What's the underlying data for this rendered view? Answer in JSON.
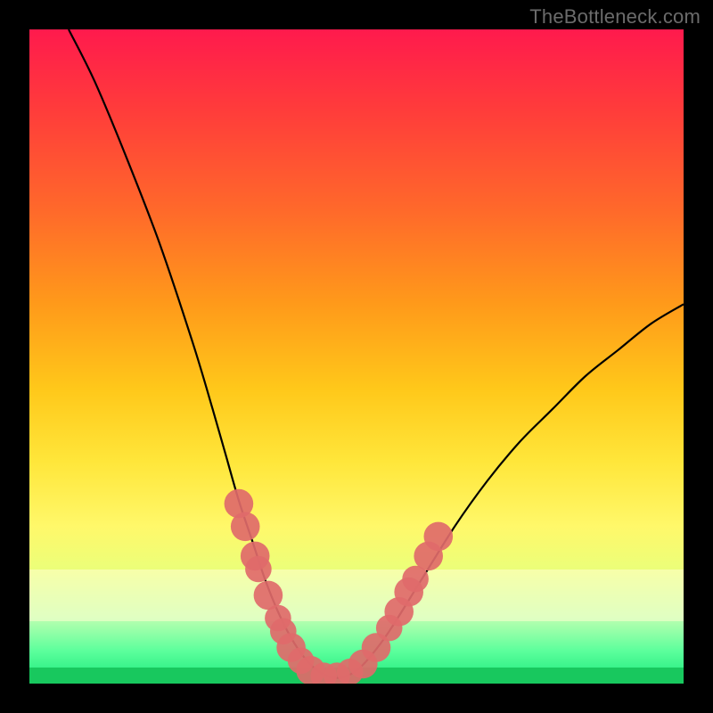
{
  "attribution": "TheBottleneck.com",
  "colors": {
    "frame": "#000000",
    "curve": "#000000",
    "bead": "#e06a6a",
    "green": "#18c85e"
  },
  "chart_data": {
    "type": "line",
    "title": "",
    "xlabel": "",
    "ylabel": "",
    "xlim": [
      0,
      100
    ],
    "ylim": [
      0,
      100
    ],
    "series": [
      {
        "name": "bottleneck-curve",
        "x": [
          6,
          10,
          15,
          20,
          25,
          28,
          30,
          32,
          34,
          36,
          38,
          40,
          42,
          44,
          46,
          48,
          50,
          52,
          55,
          60,
          65,
          70,
          75,
          80,
          85,
          90,
          95,
          100
        ],
        "y": [
          100,
          92,
          80,
          67,
          52,
          42,
          35,
          28,
          22,
          16,
          11,
          7,
          4,
          2,
          1,
          1,
          2,
          4,
          8,
          16,
          24,
          31,
          37,
          42,
          47,
          51,
          55,
          58
        ]
      }
    ],
    "markers": {
      "name": "highlight-beads",
      "points": [
        {
          "x": 32.0,
          "y": 27.5,
          "r": 1.4
        },
        {
          "x": 33.0,
          "y": 24.0,
          "r": 1.4
        },
        {
          "x": 34.5,
          "y": 19.5,
          "r": 1.4
        },
        {
          "x": 35.0,
          "y": 17.5,
          "r": 1.2
        },
        {
          "x": 36.5,
          "y": 13.5,
          "r": 1.4
        },
        {
          "x": 38.0,
          "y": 10.0,
          "r": 1.2
        },
        {
          "x": 38.8,
          "y": 8.0,
          "r": 1.2
        },
        {
          "x": 40.0,
          "y": 5.5,
          "r": 1.4
        },
        {
          "x": 41.5,
          "y": 3.5,
          "r": 1.2
        },
        {
          "x": 43.0,
          "y": 2.0,
          "r": 1.4
        },
        {
          "x": 45.0,
          "y": 1.2,
          "r": 1.2
        },
        {
          "x": 47.0,
          "y": 1.2,
          "r": 1.2
        },
        {
          "x": 49.0,
          "y": 1.8,
          "r": 1.2
        },
        {
          "x": 51.0,
          "y": 3.0,
          "r": 1.4
        },
        {
          "x": 53.0,
          "y": 5.5,
          "r": 1.4
        },
        {
          "x": 55.0,
          "y": 8.5,
          "r": 1.2
        },
        {
          "x": 56.5,
          "y": 11.0,
          "r": 1.4
        },
        {
          "x": 58.0,
          "y": 14.0,
          "r": 1.4
        },
        {
          "x": 59.0,
          "y": 16.0,
          "r": 1.2
        },
        {
          "x": 61.0,
          "y": 19.5,
          "r": 1.4
        },
        {
          "x": 62.5,
          "y": 22.5,
          "r": 1.4
        }
      ]
    }
  }
}
